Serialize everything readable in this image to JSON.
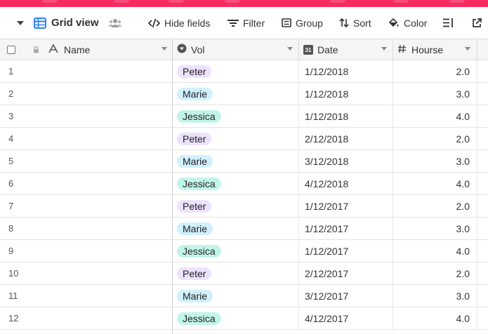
{
  "view": {
    "name": "Grid view",
    "accent_color": "#2d7ff9",
    "icons": [
      "menu-caret-icon",
      "grid-view-icon",
      "collaborators-icon"
    ]
  },
  "toolbar": {
    "hide_fields_label": "Hide fields",
    "filter_label": "Filter",
    "group_label": "Group",
    "sort_label": "Sort",
    "color_label": "Color"
  },
  "columns": [
    {
      "name": "Name",
      "icon": "text-field-icon"
    },
    {
      "name": "Vol",
      "icon": "single-select-icon"
    },
    {
      "name": "Date",
      "icon": "date-icon",
      "icon_text": "31"
    },
    {
      "name": "Hourse",
      "icon": "number-icon"
    }
  ],
  "pill_colors": {
    "Peter": "#ede2fe",
    "Marie": "#d0f0fd",
    "Jessica": "#c2f5e9"
  },
  "rows": [
    {
      "num": "1",
      "name": "",
      "vol": "Peter",
      "date": "1/12/2018",
      "hours": "2.0"
    },
    {
      "num": "2",
      "name": "",
      "vol": "Marie",
      "date": "1/12/2018",
      "hours": "3.0"
    },
    {
      "num": "3",
      "name": "",
      "vol": "Jessica",
      "date": "1/12/2018",
      "hours": "4.0"
    },
    {
      "num": "4",
      "name": "",
      "vol": "Peter",
      "date": "2/12/2018",
      "hours": "2.0"
    },
    {
      "num": "5",
      "name": "",
      "vol": "Marie",
      "date": "3/12/2018",
      "hours": "3.0"
    },
    {
      "num": "6",
      "name": "",
      "vol": "Jessica",
      "date": "4/12/2018",
      "hours": "4.0"
    },
    {
      "num": "7",
      "name": "",
      "vol": "Peter",
      "date": "1/12/2017",
      "hours": "2.0"
    },
    {
      "num": "8",
      "name": "",
      "vol": "Marie",
      "date": "1/12/2017",
      "hours": "3.0"
    },
    {
      "num": "9",
      "name": "",
      "vol": "Jessica",
      "date": "1/12/2017",
      "hours": "4.0"
    },
    {
      "num": "10",
      "name": "",
      "vol": "Peter",
      "date": "2/12/2017",
      "hours": "2.0"
    },
    {
      "num": "11",
      "name": "",
      "vol": "Marie",
      "date": "3/12/2017",
      "hours": "3.0"
    },
    {
      "num": "12",
      "name": "",
      "vol": "Jessica",
      "date": "4/12/2017",
      "hours": "4.0"
    }
  ]
}
